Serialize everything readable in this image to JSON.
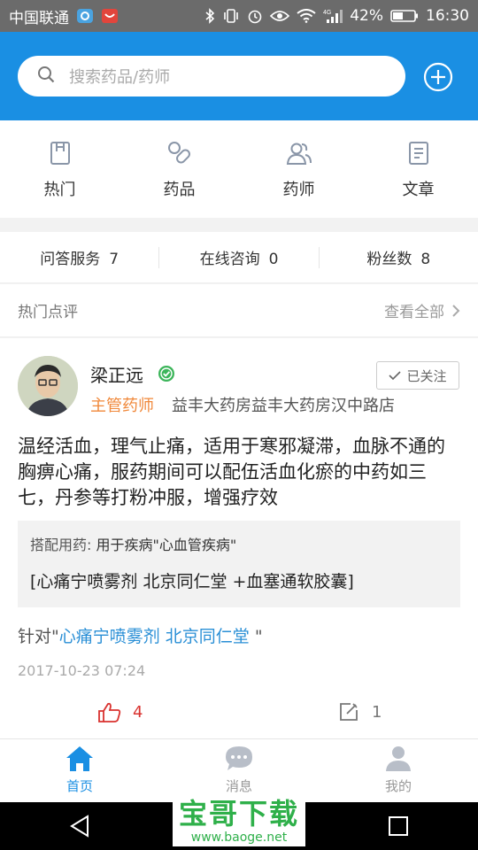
{
  "status_bar": {
    "carrier": "中国联通",
    "battery": "42%",
    "time": "16:30",
    "network": "4G"
  },
  "search": {
    "placeholder": "搜索药品/药师"
  },
  "categories": [
    {
      "label": "热门",
      "icon": "bookmark-h-icon"
    },
    {
      "label": "药品",
      "icon": "pill-icon"
    },
    {
      "label": "药师",
      "icon": "users-icon"
    },
    {
      "label": "文章",
      "icon": "document-icon"
    }
  ],
  "stats": [
    {
      "label": "问答服务",
      "value": "7"
    },
    {
      "label": "在线咨询",
      "value": "0"
    },
    {
      "label": "粉丝数",
      "value": "8"
    }
  ],
  "section": {
    "title": "热门点评",
    "more": "查看全部"
  },
  "review": {
    "name": "梁正远",
    "follow_label": "已关注",
    "role": "主管药师",
    "pharmacy": "益丰大药房益丰大药房汉中路店",
    "content": "温经活血，理气止痛，适用于寒邪凝滞，血脉不通的胸痹心痛，服药期间可以配伍活血化瘀的中药如三七，丹参等打粉冲服，增强疗效",
    "combo_prefix": "搭配用药:",
    "combo_disease": "用于疾病\"心血管疾病\"",
    "combo_drugs": "[心痛宁喷雾剂 北京同仁堂 +血塞通软胶囊]",
    "target_prefix": "针对\"",
    "target_drug": "心痛宁喷雾剂 北京同仁堂",
    "target_suffix": " \"",
    "date": "2017-10-23 07:24",
    "likes": "4",
    "comments": "1"
  },
  "tabs": [
    {
      "label": "首页",
      "active": true
    },
    {
      "label": "消息",
      "active": false
    },
    {
      "label": "我的",
      "active": false
    }
  ],
  "watermark": {
    "title": "宝哥下载",
    "url": "www.baoge.net"
  },
  "colors": {
    "primary": "#1a8fe3",
    "accent": "#f0883a",
    "like": "#d9322f",
    "link": "#2a8fd6",
    "verified": "#3cb55a"
  }
}
